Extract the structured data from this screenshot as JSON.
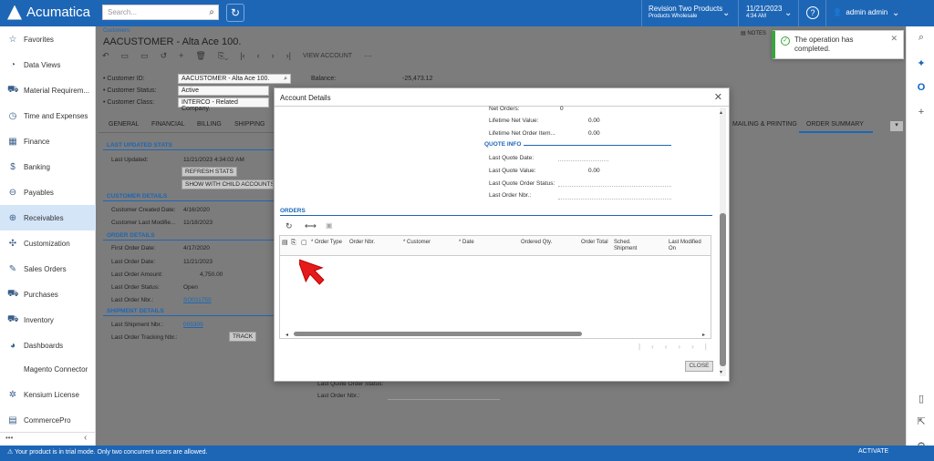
{
  "app": {
    "logo_text": "Acumatica"
  },
  "topbar": {
    "search_placeholder": "Search...",
    "company_name": "Revision Two Products",
    "company_branch": "Products Wholesale",
    "date": "11/21/2023",
    "time": "4:34 AM",
    "help": "?",
    "user": "admin admin"
  },
  "sidebar": {
    "items": [
      {
        "label": "Favorites",
        "icon": "star-icon",
        "glyph": "☆"
      },
      {
        "label": "Data Views",
        "icon": "pie-chart-icon",
        "glyph": "◔"
      },
      {
        "label": "Material Requirem...",
        "icon": "cart-icon",
        "glyph": "⛟"
      },
      {
        "label": "Time and Expenses",
        "icon": "clock-icon",
        "glyph": "◷"
      },
      {
        "label": "Finance",
        "icon": "calculator-icon",
        "glyph": "▦"
      },
      {
        "label": "Banking",
        "icon": "dollar-icon",
        "glyph": "$"
      },
      {
        "label": "Payables",
        "icon": "minus-circle-icon",
        "glyph": "⊖"
      },
      {
        "label": "Receivables",
        "icon": "plus-circle-icon",
        "glyph": "⊕"
      },
      {
        "label": "Customization",
        "icon": "puzzle-icon",
        "glyph": "✣"
      },
      {
        "label": "Sales Orders",
        "icon": "edit-icon",
        "glyph": "✎"
      },
      {
        "label": "Purchases",
        "icon": "cart-icon",
        "glyph": "⛟"
      },
      {
        "label": "Inventory",
        "icon": "truck-icon",
        "glyph": "⛟"
      },
      {
        "label": "Dashboards",
        "icon": "gauge-icon",
        "glyph": "◕"
      },
      {
        "label": "Magento Connector",
        "icon": "",
        "glyph": ""
      },
      {
        "label": "Kensium License",
        "icon": "gear-icon",
        "glyph": "✲"
      },
      {
        "label": "CommercePro",
        "icon": "grid-icon",
        "glyph": "▤"
      }
    ],
    "active": "Receivables",
    "more": "•••",
    "collapse": "‹"
  },
  "page": {
    "breadcrumb": "Customers",
    "title": "AACUSTOMER - Alta Ace 100.",
    "notes": "NOTES",
    "toolbar": {
      "view_account": "VIEW ACCOUNT",
      "more": "···"
    },
    "customer_id_label": "Customer ID:",
    "customer_id": "AACUSTOMER - Alta Ace 100.",
    "customer_status_label": "Customer Status:",
    "customer_status": "Active",
    "customer_class_label": "Customer Class:",
    "customer_class": "INTERCO - Related Company.",
    "balance_label": "Balance:",
    "balance": "-25,473.12",
    "tabs": [
      "GENERAL",
      "FINANCIAL",
      "BILLING",
      "SHIPPING",
      "MAILING & PRINTING",
      "ORDER SUMMARY"
    ],
    "last_updated_stats": "LAST UPDATED STATS",
    "last_updated_label": "Last Updated:",
    "last_updated": "11/21/2023 4:34:02 AM",
    "refresh_stats": "REFRESH STATS",
    "show_child": "SHOW WITH CHILD ACCOUNTS",
    "customer_details": "CUSTOMER DETAILS",
    "created_label": "Customer Created Date:",
    "created": "4/16/2020",
    "modified_label": "Customer Last Modifie...",
    "modified": "11/18/2023",
    "order_details": "ORDER DETAILS",
    "first_order_label": "First Order Date:",
    "first_order": "4/17/2020",
    "last_order_date_label": "Last Order Date:",
    "last_order_date": "11/21/2023",
    "last_order_amount_label": "Last Order Amount:",
    "last_order_amount": "4,750.00",
    "last_order_status_label": "Last Order Status:",
    "last_order_status": "Open",
    "last_order_nbr_label": "Last Order Nbr.:",
    "last_order_nbr": "SO011750",
    "shipment_details": "SHIPMENT DETAILS",
    "last_shipment_label": "Last Shipment Nbr.:",
    "last_shipment": "005309",
    "last_tracking_label": "Last Order Tracking Nbr.:",
    "track": "TRACK",
    "bg_last_quote_status": "Last Quote Order Status:",
    "bg_last_order_nbr": "Last Order Nbr.:"
  },
  "modal": {
    "title": "Account Details",
    "close_x": "✕",
    "net_orders_label": "Net Orders:",
    "net_orders": "0",
    "lifetime_net_value_label": "Lifetime Net Value:",
    "lifetime_net_value": "0.00",
    "lifetime_net_order_label": "Lifetime Net Order Item...",
    "lifetime_net_order": "0.00",
    "quote_info": "QUOTE INFO",
    "last_quote_date_label": "Last Quote Date:",
    "last_quote_value_label": "Last Quote Value:",
    "last_quote_value": "0.00",
    "last_quote_status_label": "Last Quote Order Status:",
    "last_order_nbr_label": "Last Order Nbr.:",
    "orders": "ORDERS",
    "columns": [
      "* Order Type",
      "Order Nbr.",
      "* Customer",
      "* Date",
      "Ordered Qty.",
      "Order Total",
      "Sched. Shipment",
      "Last Modified On"
    ],
    "close_button": "CLOSE"
  },
  "toast": {
    "message": "The operation has completed."
  },
  "footer": {
    "message": "Your product is in trial mode. Only two concurrent users are allowed.",
    "activate": "ACTIVATE"
  }
}
